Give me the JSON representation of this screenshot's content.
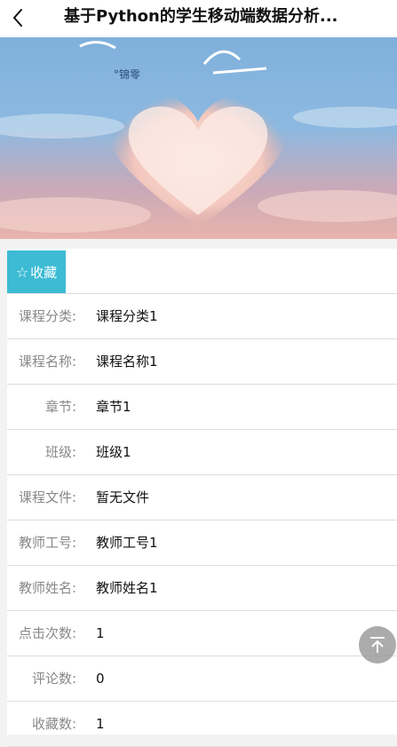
{
  "header": {
    "back_icon": "chevron-left-icon",
    "title": "基于Python的学生移动端数据分析..."
  },
  "banner": {
    "image_desc_icon": "banner-image"
  },
  "favorite": {
    "icon": "star-outline-icon",
    "label": "收藏"
  },
  "fields": [
    {
      "label": "课程分类:",
      "value": "课程分类1"
    },
    {
      "label": "课程名称:",
      "value": "课程名称1"
    },
    {
      "label": "章节:",
      "value": "章节1"
    },
    {
      "label": "班级:",
      "value": "班级1"
    },
    {
      "label": "课程文件:",
      "value": "暂无文件"
    },
    {
      "label": "教师工号:",
      "value": "教师工号1"
    },
    {
      "label": "教师姓名:",
      "value": "教师姓名1"
    },
    {
      "label": "点击次数:",
      "value": "1"
    },
    {
      "label": "评论数:",
      "value": "0"
    },
    {
      "label": "收藏数:",
      "value": "1"
    }
  ],
  "scroll_top": {
    "icon": "arrow-up-to-top-icon"
  },
  "colors": {
    "accent": "#3dbbd4",
    "label": "#888888",
    "divider": "#dcdcdc"
  }
}
